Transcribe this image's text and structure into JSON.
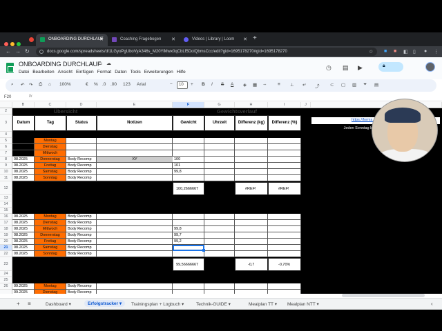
{
  "browser": {
    "tabs": [
      {
        "title": "ONBOARDING DURCHLAUF",
        "active": true
      },
      {
        "title": "Coaching Fragebogen",
        "active": false
      },
      {
        "title": "Videos | Library | Loom",
        "active": false
      }
    ],
    "url": "docs.google.com/spreadsheets/d/1LGyoPgUboVyA346s_M20YiMwx0qCbLf5DolQbmsCcc/edit?gid=1695178270#gid=1695178270"
  },
  "sheet": {
    "title": "ONBOARDING DURCHLAUF",
    "menu": [
      "Datei",
      "Bearbeiten",
      "Ansicht",
      "Einfügen",
      "Format",
      "Daten",
      "Tools",
      "Erweiterungen",
      "Hilfe"
    ],
    "toolbar": {
      "zoom": "100%",
      "currency": "€",
      "percent": "%",
      "dec1": ".0",
      "dec2": ".00",
      "numfmt": "123",
      "font": "Arial",
      "size": "10",
      "bold": "B",
      "italic": "I",
      "strike": "S",
      "textcolor": "A"
    },
    "name_box": "F20",
    "fx": "fx",
    "columns": [
      "B",
      "C",
      "D",
      "E",
      "F",
      "G",
      "H",
      "I",
      "J"
    ],
    "rows": [
      "2",
      "3",
      "4",
      "5",
      "6",
      "7",
      "8",
      "9",
      "10",
      "11",
      "12",
      "13",
      "14",
      "15",
      "16",
      "17",
      "18",
      "19",
      "20",
      "21",
      "22",
      "23",
      "24",
      "25",
      "26"
    ]
  },
  "content": {
    "section_uebersicht": "Übersicht",
    "section_gewicht": "Gewichtsverlauf",
    "headers": [
      "Datum",
      "Tag",
      "Status",
      "Notizen",
      "Gewicht",
      "Uhrzeit",
      "Differenz (kg)",
      "Differenz (%)"
    ],
    "link": "https://forms.gle/A4l",
    "link_tail": "ore",
    "note": "Jeden Sonntag bis 13:00 Uhr ausfüllen",
    "week1": {
      "days": [
        "Montag",
        "Dienstag",
        "Mittwoch",
        "Donnerstag",
        "Freitag",
        "Samstag",
        "Sonntag"
      ],
      "dates": [
        "",
        "",
        "",
        "08.2025",
        "08.2025",
        "08.2025",
        "08.2025"
      ],
      "status": [
        "",
        "",
        "",
        "Body Recomp",
        "Body Recomp",
        "Body Recomp",
        "Body Recomp"
      ],
      "note_xy": "XY",
      "weights": [
        "",
        "",
        "",
        "100",
        "101",
        "99,8",
        ""
      ],
      "avg": "100,2666667",
      "diff_kg": "#REF!",
      "diff_pct": "#REF!"
    },
    "week2": {
      "days": [
        "Montag",
        "Dienstag",
        "Mittwoch",
        "Donnerstag",
        "Freitag",
        "Samstag",
        "Sonntag"
      ],
      "dates": [
        "08.2025",
        "08.2025",
        "08.2025",
        "08.2025",
        "08.2025",
        "08.2025",
        "08.2025"
      ],
      "status": [
        "Body Recomp",
        "Body Recomp",
        "Body Recomp",
        "Body Recomp",
        "Body Recomp",
        "Body Recomp",
        "Body Recomp"
      ],
      "weights": [
        "",
        "",
        "99,8",
        "99,7",
        "99,2",
        "",
        ""
      ],
      "avg": "99,56666667",
      "diff_kg": "-0,7",
      "diff_pct": "-0,70%"
    },
    "week3": {
      "days": [
        "Montag",
        "Dienstag"
      ],
      "dates": [
        "09.2025",
        "09.2025"
      ],
      "status": [
        "Body Recomp",
        "Body Recomp"
      ]
    }
  },
  "sheet_tabs": [
    {
      "label": "Dashboard",
      "active": false
    },
    {
      "label": "Erfolgstracker",
      "active": true
    },
    {
      "label": "Trainingsplan + Logbuch",
      "active": false
    },
    {
      "label": "Technik-GUIDE",
      "active": false
    },
    {
      "label": "Mealplan TT",
      "active": false
    },
    {
      "label": "Mealplan NTT",
      "active": false
    }
  ]
}
